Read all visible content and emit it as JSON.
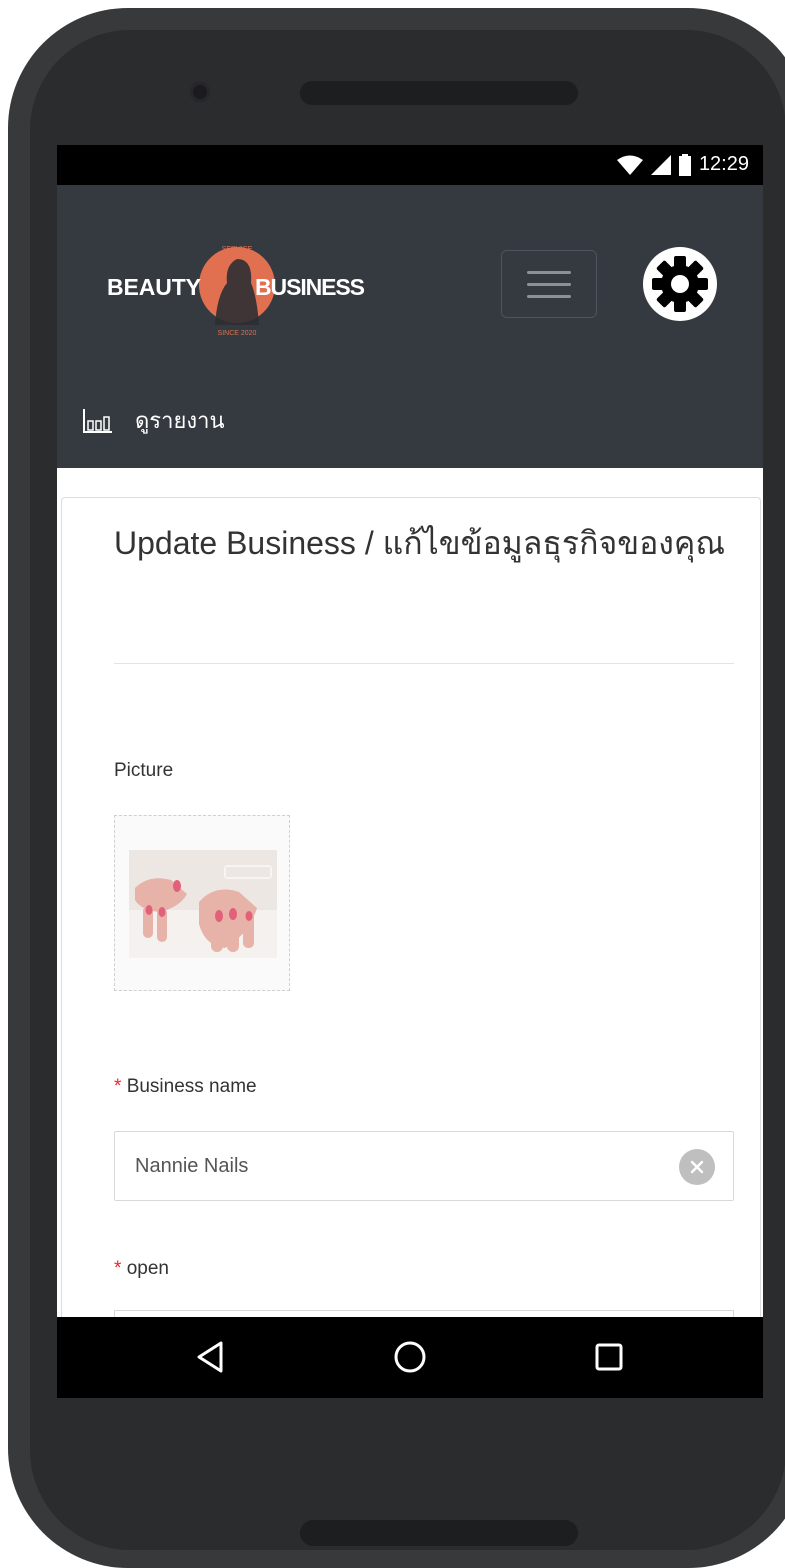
{
  "status_bar": {
    "time": "12:29"
  },
  "header": {
    "logo": {
      "top": "SERVICE",
      "left": "BEAUTY",
      "right": "BUSINESS",
      "bottom": "SINCE 2020"
    },
    "report_label": "ดูรายงาน"
  },
  "form": {
    "title": "Update Business / แก้ไขข้อมูลธุรกิจของคุณ",
    "picture_label": "Picture",
    "business_name_label": "Business name",
    "business_name_value": "Nannie Nails",
    "open_label": "open",
    "required_mark": "*"
  },
  "colors": {
    "header_bg": "#343a40",
    "logo_accent": "#e07050",
    "required": "#f5222d"
  },
  "icons": [
    "wifi-icon",
    "signal-icon",
    "battery-icon",
    "menu-icon",
    "gear-icon",
    "bar-chart-icon",
    "clear-icon",
    "back-icon",
    "home-icon",
    "recents-icon"
  ]
}
